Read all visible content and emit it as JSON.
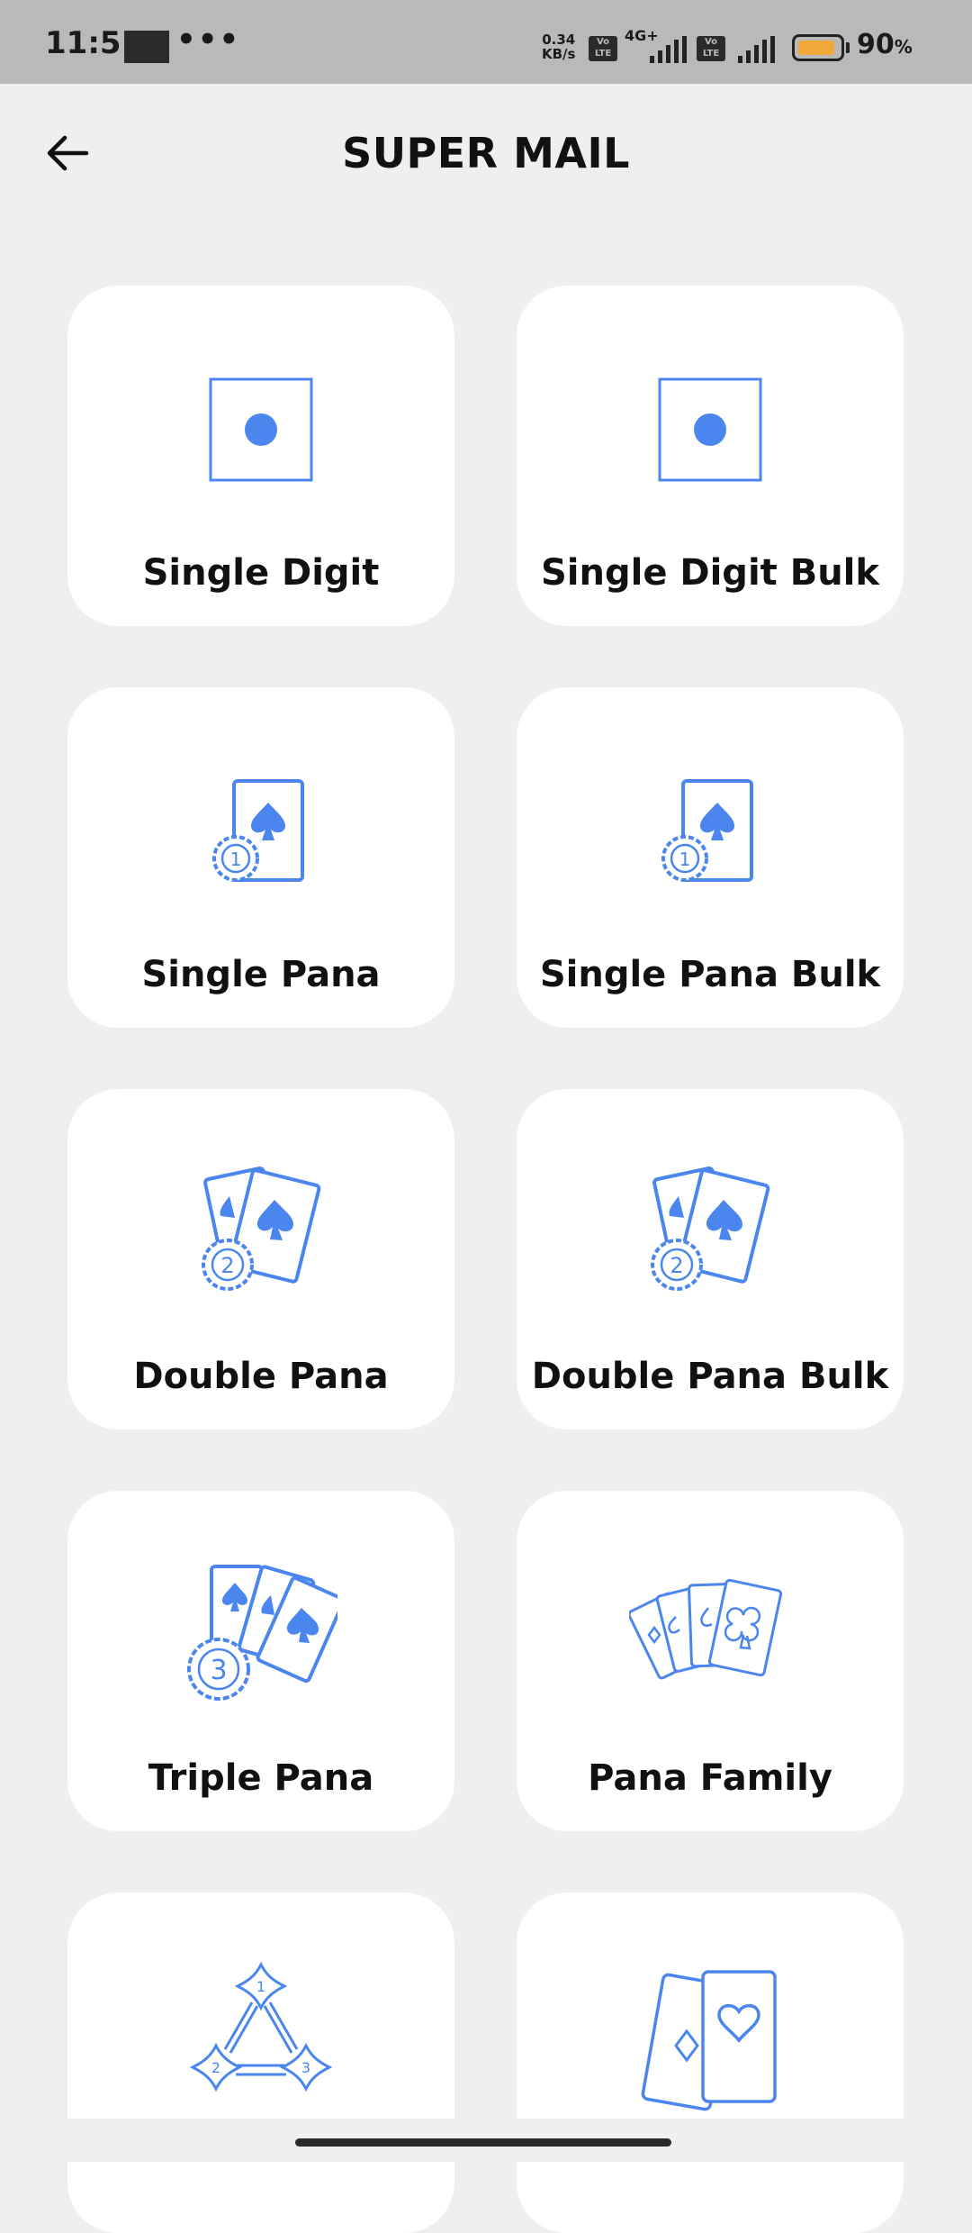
{
  "status_bar": {
    "time": "11:51",
    "dots": "•••",
    "speed_value": "0.34",
    "speed_unit": "KB/s",
    "volte_label": "Vo LTE",
    "network": "4G+",
    "battery_percent": "90",
    "battery_symbol": "%",
    "battery_level": 0.9,
    "battery_color": "#f2a93b"
  },
  "header": {
    "title": "SUPER MAIL"
  },
  "accent_color": "#4a86ee",
  "cards": [
    {
      "label": "Single Digit",
      "icon": "die-icon"
    },
    {
      "label": "Single Digit Bulk",
      "icon": "die-icon"
    },
    {
      "label": "Single Pana",
      "icon": "card-chip-1-icon"
    },
    {
      "label": "Single Pana Bulk",
      "icon": "card-chip-1-icon"
    },
    {
      "label": "Double Pana",
      "icon": "cards-chip-2-icon"
    },
    {
      "label": "Double Pana Bulk",
      "icon": "cards-chip-2-icon"
    },
    {
      "label": "Triple Pana",
      "icon": "cards-chip-3-icon"
    },
    {
      "label": "Pana Family",
      "icon": "card-fan-icon"
    },
    {
      "label": "",
      "icon": "diamond-triangle-icon"
    },
    {
      "label": "",
      "icon": "two-cards-icon"
    }
  ]
}
